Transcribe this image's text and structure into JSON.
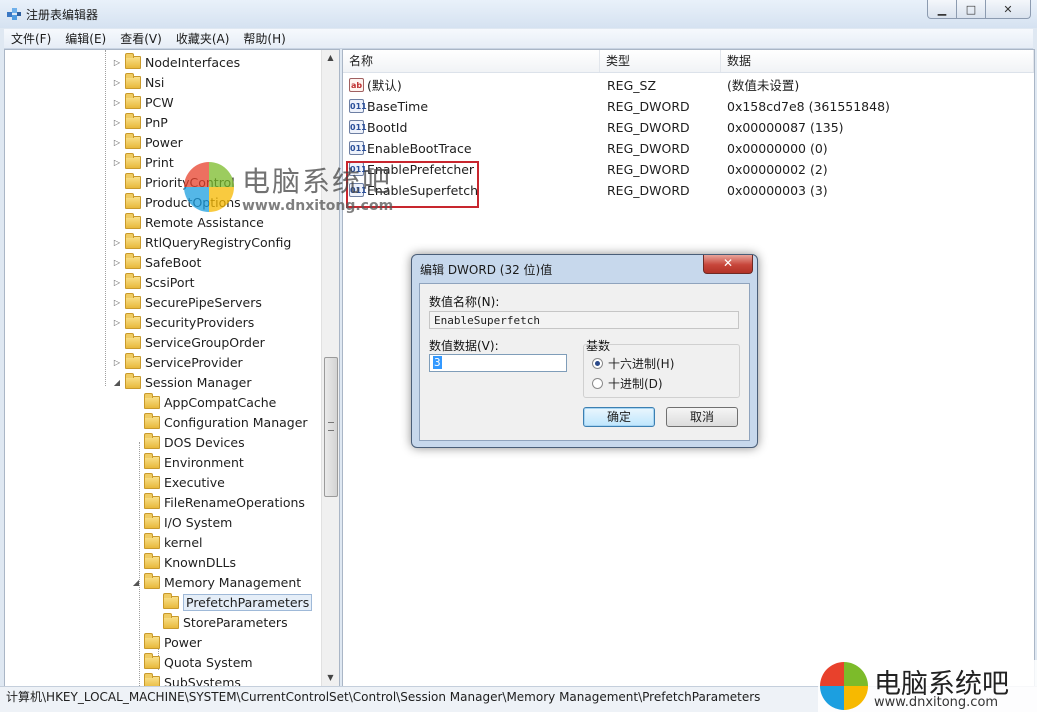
{
  "window": {
    "title": "注册表编辑器",
    "buttons": {
      "minimize": "▁",
      "maximize": "□",
      "close": "✕"
    }
  },
  "menu": [
    "文件(F)",
    "编辑(E)",
    "查看(V)",
    "收藏夹(A)",
    "帮助(H)"
  ],
  "tree": {
    "nodes": [
      {
        "label": "NodeInterfaces",
        "expander": "▷"
      },
      {
        "label": "Nsi",
        "expander": "▷"
      },
      {
        "label": "PCW",
        "expander": "▷"
      },
      {
        "label": "PnP",
        "expander": "▷"
      },
      {
        "label": "Power",
        "expander": "▷"
      },
      {
        "label": "Print",
        "expander": "▷"
      },
      {
        "label": "PriorityControl",
        "expander": ""
      },
      {
        "label": "ProductOptions",
        "expander": ""
      },
      {
        "label": "Remote Assistance",
        "expander": ""
      },
      {
        "label": "RtlQueryRegistryConfig",
        "expander": "▷"
      },
      {
        "label": "SafeBoot",
        "expander": "▷"
      },
      {
        "label": "ScsiPort",
        "expander": "▷"
      },
      {
        "label": "SecurePipeServers",
        "expander": "▷"
      },
      {
        "label": "SecurityProviders",
        "expander": "▷"
      },
      {
        "label": "ServiceGroupOrder",
        "expander": ""
      },
      {
        "label": "ServiceProvider",
        "expander": "▷"
      },
      {
        "label": "Session Manager",
        "expander": "◢"
      },
      {
        "label": "AppCompatCache",
        "expander": ""
      },
      {
        "label": "Configuration Manager",
        "expander": ""
      },
      {
        "label": "DOS Devices",
        "expander": ""
      },
      {
        "label": "Environment",
        "expander": ""
      },
      {
        "label": "Executive",
        "expander": ""
      },
      {
        "label": "FileRenameOperations",
        "expander": ""
      },
      {
        "label": "I/O System",
        "expander": ""
      },
      {
        "label": "kernel",
        "expander": ""
      },
      {
        "label": "KnownDLLs",
        "expander": ""
      },
      {
        "label": "Memory Management",
        "expander": "◢"
      },
      {
        "label": "PrefetchParameters",
        "expander": ""
      },
      {
        "label": "StoreParameters",
        "expander": ""
      },
      {
        "label": "Power",
        "expander": ""
      },
      {
        "label": "Quota System",
        "expander": ""
      },
      {
        "label": "SubSystems",
        "expander": ""
      }
    ],
    "scroll_up": "▲",
    "scroll_down": "▼"
  },
  "list": {
    "columns": [
      "名称",
      "类型",
      "数据"
    ],
    "rows": [
      {
        "name": "(默认)",
        "type": "REG_SZ",
        "data": "(数值未设置)",
        "icon": "ab"
      },
      {
        "name": "BaseTime",
        "type": "REG_DWORD",
        "data": "0x158cd7e8 (361551848)",
        "icon": "011"
      },
      {
        "name": "BootId",
        "type": "REG_DWORD",
        "data": "0x00000087 (135)",
        "icon": "011"
      },
      {
        "name": "EnableBootTrace",
        "type": "REG_DWORD",
        "data": "0x00000000 (0)",
        "icon": "011"
      },
      {
        "name": "EnablePrefetcher",
        "type": "REG_DWORD",
        "data": "0x00000002 (2)",
        "icon": "011"
      },
      {
        "name": "EnableSuperfetch",
        "type": "REG_DWORD",
        "data": "0x00000003 (3)",
        "icon": "011"
      }
    ]
  },
  "status_path": "计算机\\HKEY_LOCAL_MACHINE\\SYSTEM\\CurrentControlSet\\Control\\Session Manager\\Memory Management\\PrefetchParameters",
  "dialog": {
    "title": "编辑 DWORD (32 位)值",
    "close": "✕",
    "name_label": "数值名称(N):",
    "name_value": "EnableSuperfetch",
    "data_label": "数值数据(V):",
    "data_value": "3",
    "base_label": "基数",
    "radio_hex": "十六进制(H)",
    "radio_dec": "十进制(D)",
    "ok": "确定",
    "cancel": "取消"
  },
  "watermark": {
    "cn": "电脑系统吧",
    "url": "www.dnxitong.com",
    "colors": [
      "#e8412c",
      "#7cbb2a",
      "#1c9fe0",
      "#f7b900"
    ]
  }
}
